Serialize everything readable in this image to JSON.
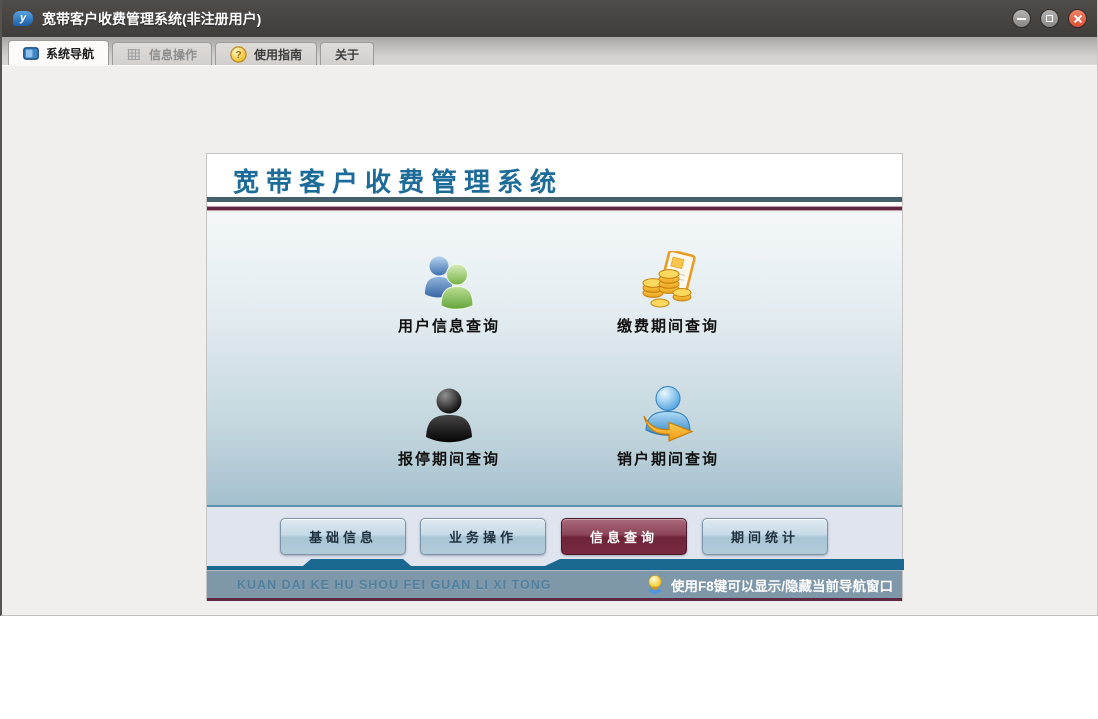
{
  "window": {
    "title": "宽带客户收费管理系统(非注册用户)",
    "logo_letter": "y"
  },
  "tab_bar": {
    "tabs": [
      {
        "label": "系统导航",
        "icon": "monitor-icon",
        "state": "active"
      },
      {
        "label": "信息操作",
        "icon": "grid-icon",
        "state": "disabled"
      },
      {
        "label": "使用指南",
        "icon": "help-icon",
        "state": "normal",
        "icon_glyph": "?"
      },
      {
        "label": "关于",
        "icon": null,
        "state": "normal"
      }
    ]
  },
  "panel": {
    "header_title": "宽带客户收费管理系统",
    "shortcut_items": [
      {
        "label": "用户信息查询",
        "icon": "users-icon"
      },
      {
        "label": "缴费期间查询",
        "icon": "coins-icon"
      },
      {
        "label": "报停期间查询",
        "icon": "person-icon"
      },
      {
        "label": "销户期间查询",
        "icon": "person-arrow-icon"
      }
    ],
    "category_buttons": [
      {
        "label": "基础信息",
        "active": false
      },
      {
        "label": "业务操作",
        "active": false
      },
      {
        "label": "信息查询",
        "active": true
      },
      {
        "label": "期间统计",
        "active": false
      }
    ],
    "status_bar": {
      "left_text": "KUAN DAI KE HU SHOU FEI GUAN LI XI TONG",
      "tip_prefix": "使用",
      "tip_key": "F8",
      "tip_suffix": "键可以显示/隐藏当前导航窗口"
    }
  },
  "colors": {
    "accent_blue": "#1d6b98",
    "maroon": "#5f2840",
    "teal_bar": "#1a6890",
    "status_bg": "#7e97a9",
    "close_button": "#dd4f35"
  }
}
